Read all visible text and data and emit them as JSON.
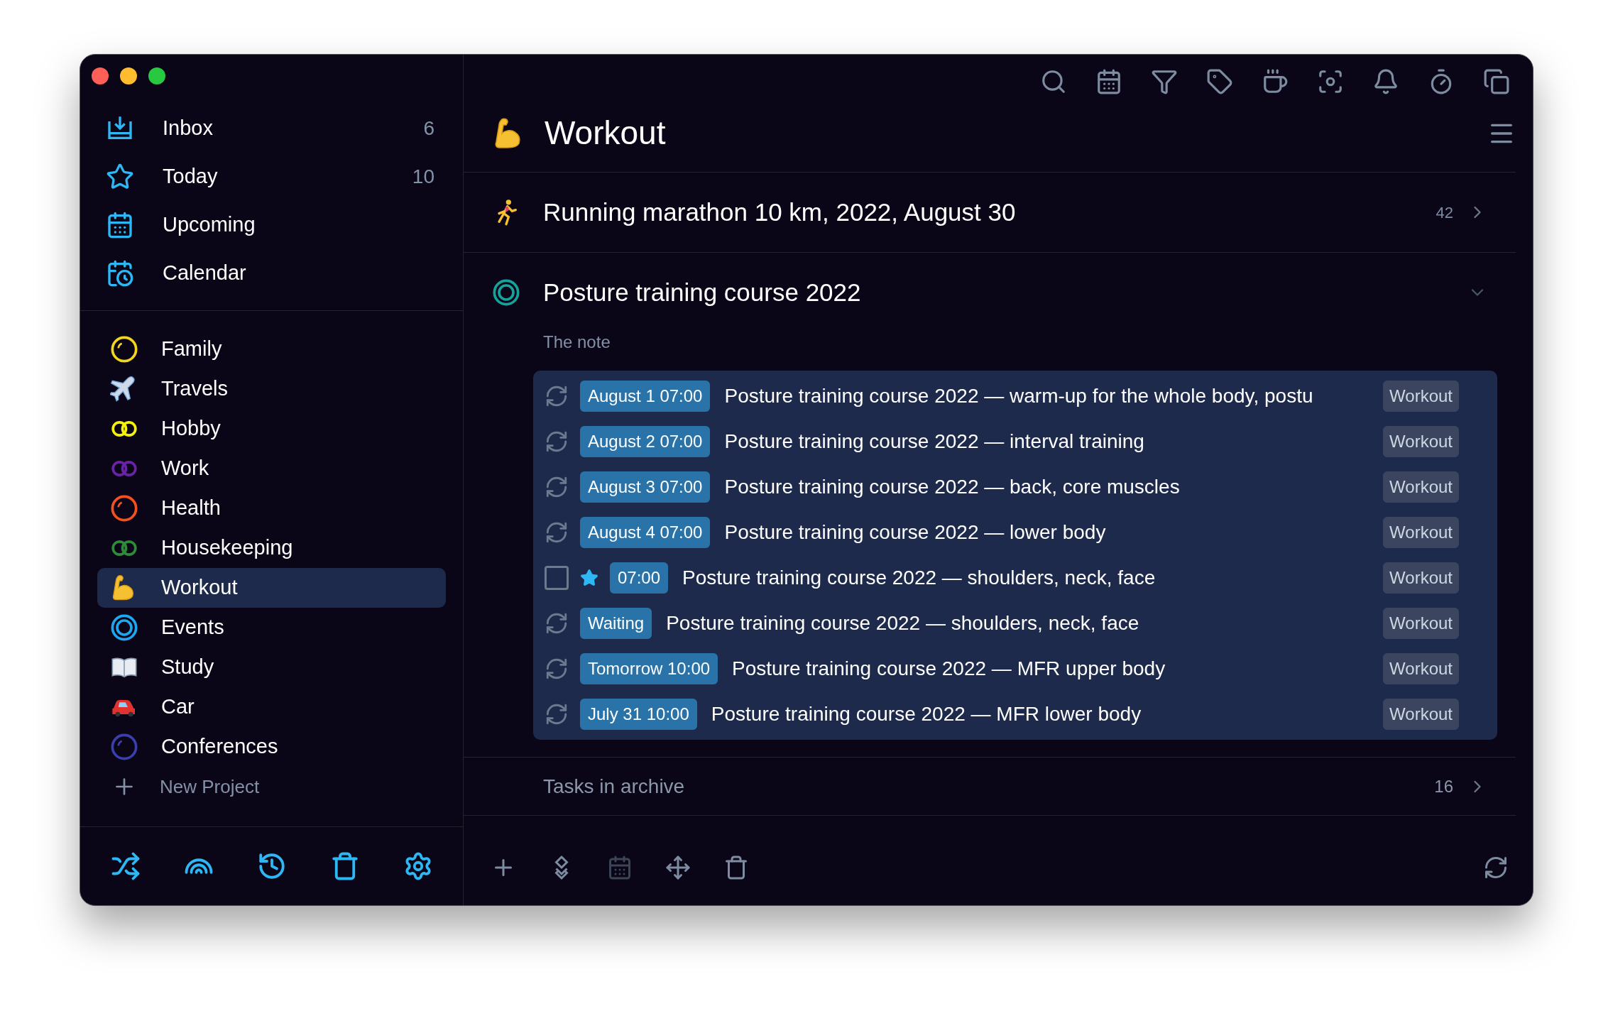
{
  "sidebar": {
    "nav": [
      {
        "label": "Inbox",
        "count": "6",
        "kind": "inbox"
      },
      {
        "label": "Today",
        "count": "10",
        "kind": "star"
      },
      {
        "label": "Upcoming",
        "kind": "calendar"
      },
      {
        "label": "Calendar",
        "kind": "calendar-clock"
      }
    ],
    "projects": [
      {
        "label": "Family",
        "kind": "ring",
        "color": "#f2d51c",
        "selected": false
      },
      {
        "label": "Travels",
        "kind": "plane",
        "selected": false
      },
      {
        "label": "Hobby",
        "kind": "rings",
        "color": "#f5f10c",
        "selected": false
      },
      {
        "label": "Work",
        "kind": "rings",
        "color": "#6a22a6",
        "selected": false
      },
      {
        "label": "Health",
        "kind": "ring",
        "color": "#f4511e",
        "selected": false
      },
      {
        "label": "Housekeeping",
        "kind": "rings",
        "color": "#2e8b3a",
        "selected": false
      },
      {
        "label": "Workout",
        "kind": "arm",
        "selected": true
      },
      {
        "label": "Events",
        "kind": "target",
        "color": "#1ea7f0",
        "selected": false
      },
      {
        "label": "Study",
        "kind": "book",
        "selected": false
      },
      {
        "label": "Car",
        "kind": "car",
        "selected": false
      },
      {
        "label": "Conferences",
        "kind": "ring",
        "color": "#3a3fae",
        "selected": false
      }
    ],
    "new_project": "New Project"
  },
  "main": {
    "title": {
      "text": "Workout",
      "kind": "arm"
    },
    "headings": [
      {
        "title": "Running marathon 10 km, 2022, August 30",
        "kind": "runner",
        "count": "42",
        "expanded": false
      },
      {
        "title": "Posture training course 2022",
        "kind": "target",
        "color": "#14a39a",
        "expanded": true,
        "note": "The note",
        "tasks": [
          {
            "kind": "repeat",
            "starred": false,
            "date": "August 1 07:00",
            "title": "Posture training course 2022 — warm-up for the whole body, postu",
            "tag": "Workout"
          },
          {
            "kind": "repeat",
            "starred": false,
            "date": "August 2 07:00",
            "title": "Posture training course 2022 — interval training",
            "tag": "Workout"
          },
          {
            "kind": "repeat",
            "starred": false,
            "date": "August 3 07:00",
            "title": "Posture training course 2022 — back, core muscles",
            "tag": "Workout"
          },
          {
            "kind": "repeat",
            "starred": false,
            "date": "August 4 07:00",
            "title": "Posture training course 2022 — lower body",
            "tag": "Workout"
          },
          {
            "kind": "checkbox",
            "checked": false,
            "starred": true,
            "date": "07:00",
            "title": "Posture training course 2022 — shoulders, neck, face",
            "tag": "Workout"
          },
          {
            "kind": "repeat",
            "starred": false,
            "date": "Waiting",
            "title": "Posture training course 2022 — shoulders, neck, face",
            "tag": "Workout"
          },
          {
            "kind": "repeat",
            "starred": false,
            "date": "Tomorrow 10:00",
            "title": "Posture training course 2022 — MFR upper body",
            "tag": "Workout"
          },
          {
            "kind": "repeat",
            "starred": false,
            "date": "July 31 10:00",
            "title": "Posture training course 2022 — MFR lower body",
            "tag": "Workout"
          }
        ]
      }
    ],
    "archive": {
      "label": "Tasks in archive",
      "count": "16"
    }
  }
}
